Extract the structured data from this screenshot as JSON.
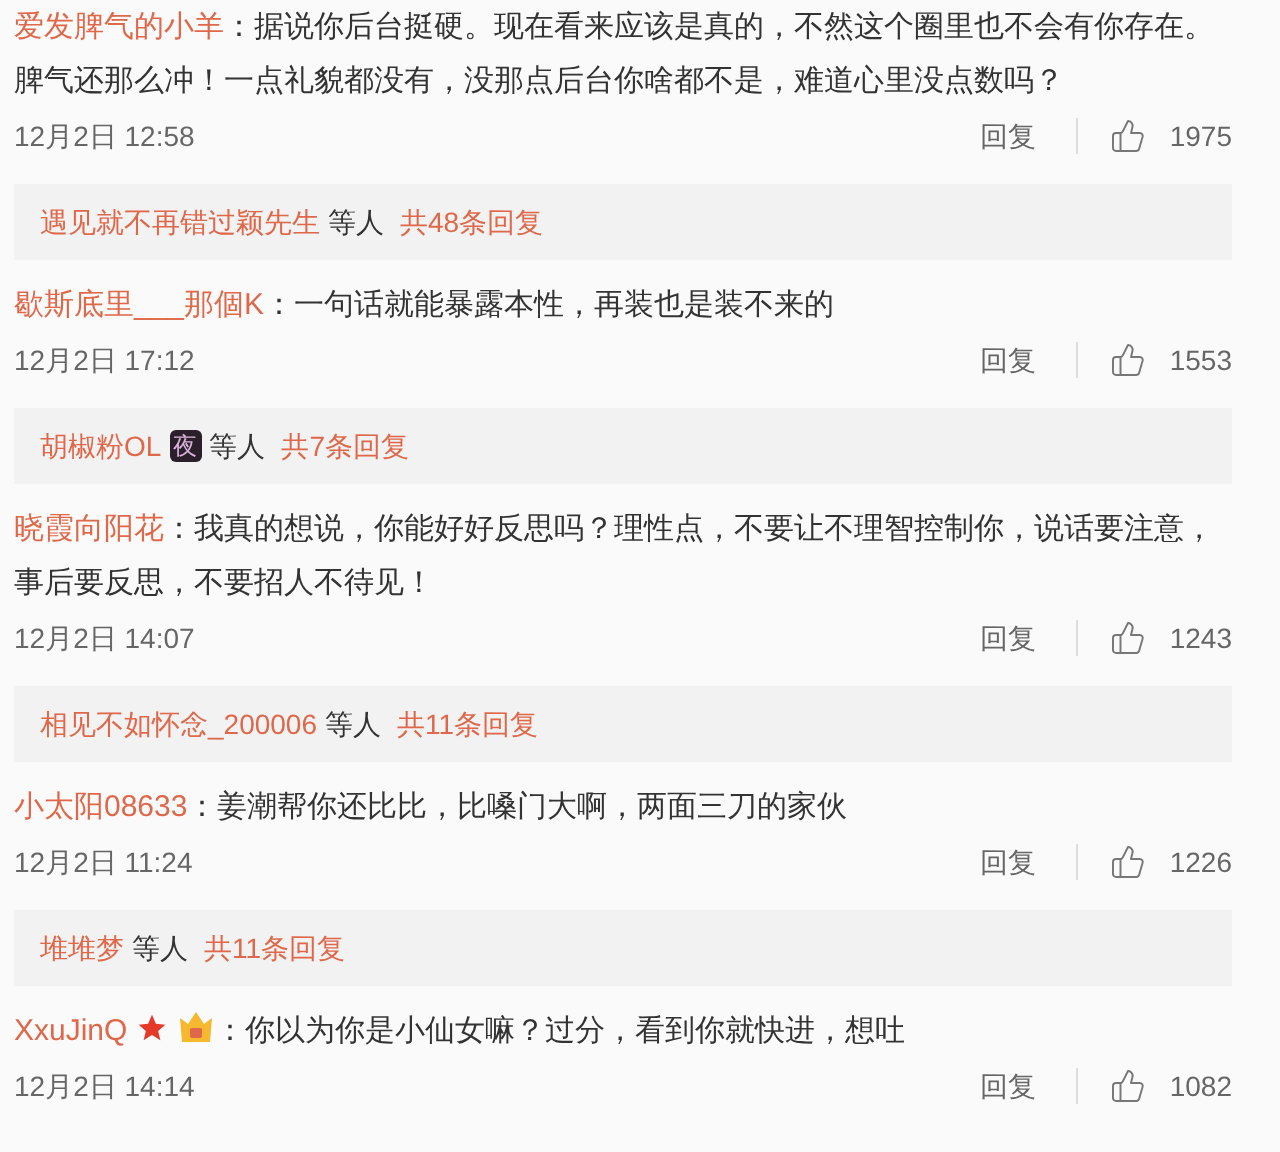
{
  "comments": [
    {
      "author": "爱发脾气的小羊",
      "kind": "plain",
      "text": "：据说你后台挺硬。现在看来应该是真的，不然这个圈里也不会有你存在。脾气还那么冲！一点礼貌都没有，没那点后台你啥都不是，难道心里没点数吗？",
      "date": "12月2日 12:58",
      "reply_label": "回复",
      "likes": "1975",
      "replies": {
        "names": "遇见就不再错过颖先生",
        "etc": "等人",
        "total": "共48条回复"
      }
    },
    {
      "author": "歇斯底里___那個K",
      "kind": "plain",
      "text": "：一句话就能暴露本性，再装也是装不来的",
      "date": "12月2日 17:12",
      "reply_label": "回复",
      "likes": "1553",
      "replies": {
        "names": "胡椒粉OL",
        "badge": "夜",
        "etc": "等人",
        "total": "共7条回复"
      }
    },
    {
      "author": "晓霞向阳花",
      "kind": "plain",
      "text": "：我真的想说，你能好好反思吗？理性点，不要让不理智控制你，说话要注意，事后要反思，不要招人不待见！",
      "date": "12月2日 14:07",
      "reply_label": "回复",
      "likes": "1243",
      "replies": {
        "names": "相见不如怀念_200006",
        "etc": "等人",
        "total": "共11条回复"
      }
    },
    {
      "author": "小太阳08633",
      "kind": "plain",
      "text": "：姜潮帮你还比比，比嗓门大啊，两面三刀的家伙",
      "date": "12月2日 11:24",
      "reply_label": "回复",
      "likes": "1226",
      "replies": {
        "names": "堆堆梦",
        "etc": "等人",
        "total": "共11条回复"
      }
    },
    {
      "author": "XxuJinQ",
      "kind": "badged",
      "text": "：你以为你是小仙女嘛？过分，看到你就快进，想吐",
      "date": "12月2日 14:14",
      "reply_label": "回复",
      "likes": "1082"
    }
  ]
}
